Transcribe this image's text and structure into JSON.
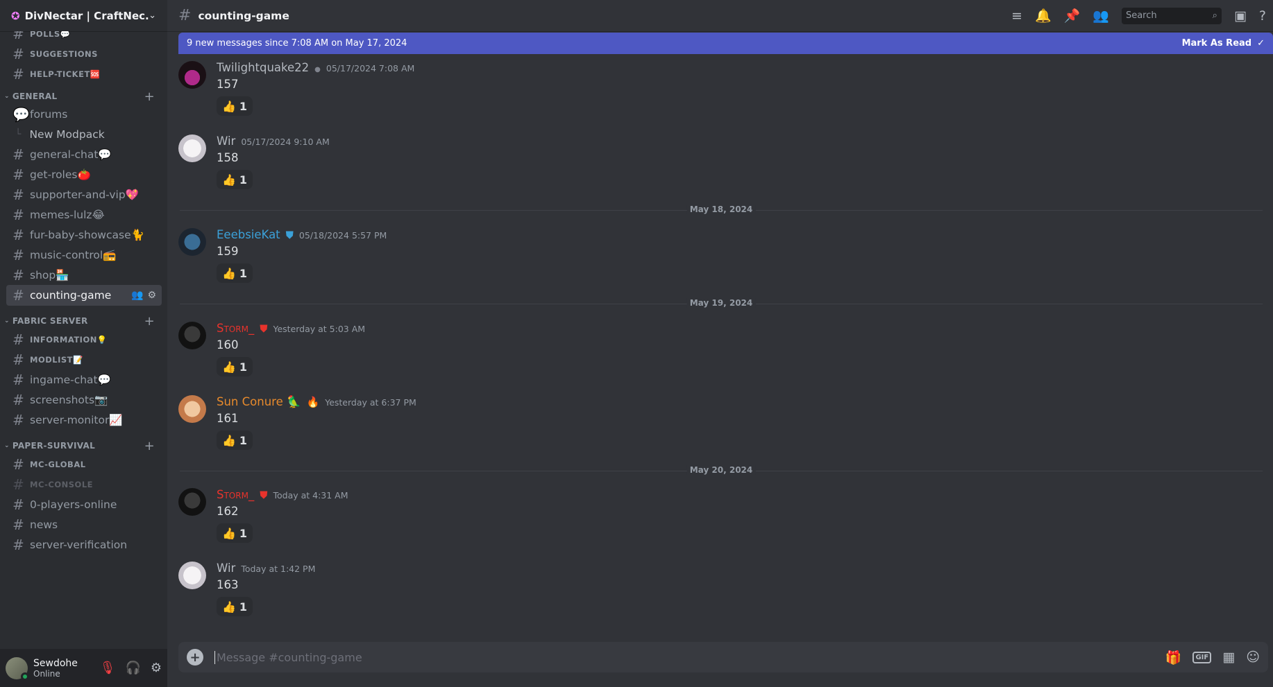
{
  "server": {
    "name": "DivNectar | CraftNec...",
    "icon": "compass-icon"
  },
  "sidebar": {
    "top_channels": [
      {
        "label": "POLLS💬",
        "smallcaps": true
      },
      {
        "label": "SUGGESTIONS",
        "smallcaps": true
      },
      {
        "label": "HELP-TICKET🆘",
        "smallcaps": true
      }
    ],
    "categories": [
      {
        "label": "GENERAL"
      },
      {
        "label": "FABRIC SERVER"
      },
      {
        "label": "PAPER-SURVIVAL"
      }
    ],
    "general": {
      "forum": "forums",
      "thread": "New Modpack",
      "channels": [
        "general-chat💬",
        "get-roles🍅",
        "supporter-and-vip💖",
        "memes-lulz😂",
        "fur-baby-showcase🐈",
        "music-control📻",
        "shop🏪",
        "counting-game"
      ]
    },
    "fabric": [
      "INFORMATION💡",
      "MODLIST📝",
      "ingame-chat💬",
      "screenshots📷",
      "server-monitor📈"
    ],
    "paper": [
      "MC-GLOBAL",
      "MC-CONSOLE",
      "0-players-online",
      "news",
      "server-verification"
    ]
  },
  "user": {
    "name": "Sewdohe",
    "status": "Online"
  },
  "topbar": {
    "channel": "counting-game",
    "search_placeholder": "Search",
    "icons": [
      "threads-icon",
      "bell-icon",
      "pin-icon",
      "members-icon",
      "inbox-icon",
      "help-icon"
    ]
  },
  "newbar": {
    "text": "9 new messages since 7:08 AM on May 17, 2024",
    "action": "Mark As Read"
  },
  "dividers": [
    "May 18, 2024",
    "May 19, 2024",
    "May 20, 2024"
  ],
  "messages": [
    {
      "author": "Twilightquake22",
      "color": "#b5bac1",
      "timestamp": "05/17/2024 7:08 AM",
      "content": "157",
      "reaction": "1"
    },
    {
      "author": "Wir",
      "color": "#b5bac1",
      "timestamp": "05/17/2024 9:10 AM",
      "content": "158",
      "reaction": "1"
    },
    {
      "author": "EeebsieKat",
      "color": "#3ba1d9",
      "timestamp": "05/18/2024 5:57 PM",
      "content": "159",
      "reaction": "1"
    },
    {
      "author": "Storm_",
      "color": "#e8332c",
      "timestamp": "Yesterday at 5:03 AM",
      "content": "160",
      "reaction": "1"
    },
    {
      "author": "Sun Conure 🦜",
      "color": "#e78a2c",
      "timestamp": "Yesterday at 6:37 PM",
      "content": "161",
      "reaction": "1"
    },
    {
      "author": "Storm_",
      "color": "#e8332c",
      "timestamp": "Today at 4:31 AM",
      "content": "162",
      "reaction": "1"
    },
    {
      "author": "Wir",
      "color": "#b5bac1",
      "timestamp": "Today at 1:42 PM",
      "content": "163",
      "reaction": "1"
    }
  ],
  "composer": {
    "placeholder": "Message #counting-game"
  }
}
